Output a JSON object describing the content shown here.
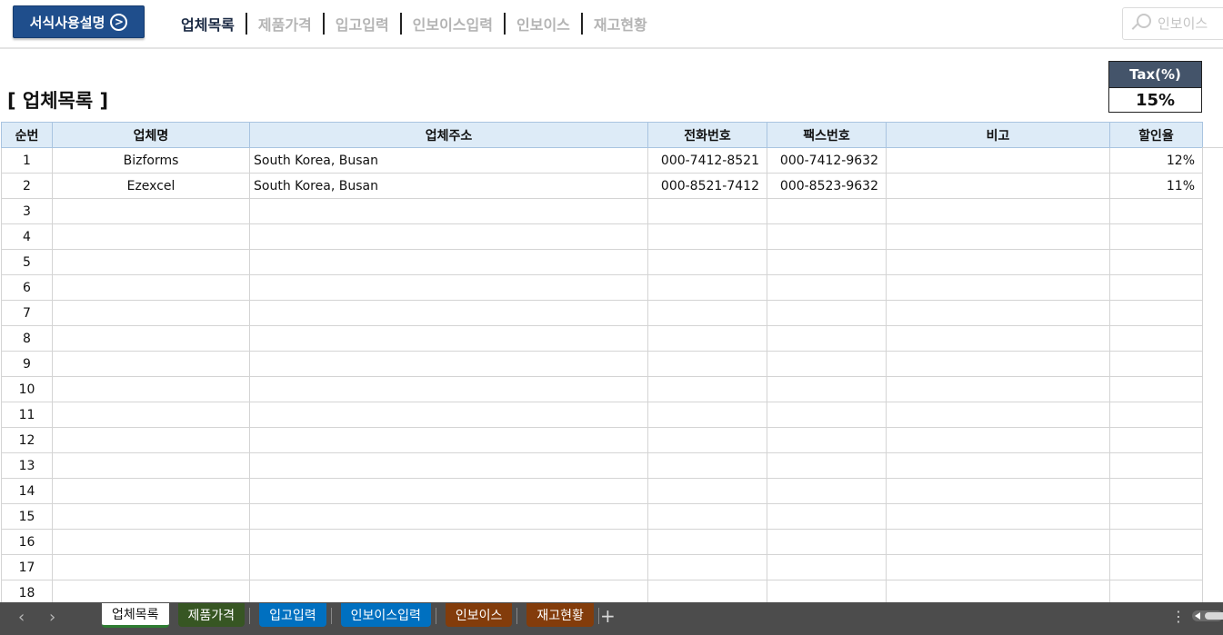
{
  "header": {
    "guide_button": "서식사용설명",
    "guide_arrow": ">",
    "nav": [
      {
        "label": "업체목록",
        "active": true
      },
      {
        "label": "제품가격",
        "active": false
      },
      {
        "label": "입고입력",
        "active": false
      },
      {
        "label": "인보이스입력",
        "active": false
      },
      {
        "label": "인보이스",
        "active": false
      },
      {
        "label": "재고현황",
        "active": false
      }
    ],
    "search_placeholder": "인보이스"
  },
  "page_title": "[ 업체목록 ]",
  "tax": {
    "label": "Tax(%)",
    "value": "15%"
  },
  "table": {
    "columns": [
      "순번",
      "업체명",
      "업체주소",
      "전화번호",
      "팩스번호",
      "비고",
      "할인율"
    ],
    "rows": [
      [
        "1",
        "Bizforms",
        "South Korea, Busan",
        "000-7412-8521",
        "000-7412-9632",
        "",
        "12%"
      ],
      [
        "2",
        "Ezexcel",
        "South Korea, Busan",
        "000-8521-7412",
        "000-8523-9632",
        "",
        "11%"
      ],
      [
        "3",
        "",
        "",
        "",
        "",
        "",
        ""
      ],
      [
        "4",
        "",
        "",
        "",
        "",
        "",
        ""
      ],
      [
        "5",
        "",
        "",
        "",
        "",
        "",
        ""
      ],
      [
        "6",
        "",
        "",
        "",
        "",
        "",
        ""
      ],
      [
        "7",
        "",
        "",
        "",
        "",
        "",
        ""
      ],
      [
        "8",
        "",
        "",
        "",
        "",
        "",
        ""
      ],
      [
        "9",
        "",
        "",
        "",
        "",
        "",
        ""
      ],
      [
        "10",
        "",
        "",
        "",
        "",
        "",
        ""
      ],
      [
        "11",
        "",
        "",
        "",
        "",
        "",
        ""
      ],
      [
        "12",
        "",
        "",
        "",
        "",
        "",
        ""
      ],
      [
        "13",
        "",
        "",
        "",
        "",
        "",
        ""
      ],
      [
        "14",
        "",
        "",
        "",
        "",
        "",
        ""
      ],
      [
        "15",
        "",
        "",
        "",
        "",
        "",
        ""
      ],
      [
        "16",
        "",
        "",
        "",
        "",
        "",
        ""
      ],
      [
        "17",
        "",
        "",
        "",
        "",
        "",
        ""
      ],
      [
        "18",
        "",
        "",
        "",
        "",
        "",
        ""
      ]
    ]
  },
  "sheet_tabs": [
    {
      "label": "업체목록",
      "color": "#ffffff",
      "active": true
    },
    {
      "label": "제품가격",
      "color": "#375623",
      "active": false
    },
    {
      "label": "입고입력",
      "color": "#0070c0",
      "active": false
    },
    {
      "label": "인보이스입력",
      "color": "#0070c0",
      "active": false
    },
    {
      "label": "인보이스",
      "color": "#833c0b",
      "active": false
    },
    {
      "label": "재고현황",
      "color": "#833c0b",
      "active": false
    }
  ],
  "tabbar": {
    "prev": "‹",
    "next": "›",
    "add": "+",
    "more": "⋮"
  }
}
